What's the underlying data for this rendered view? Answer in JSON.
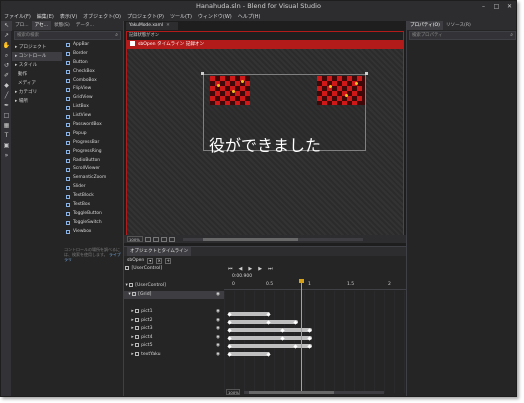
{
  "window": {
    "title": "Hanahuda.sln - Blend for Visual Studio",
    "controls": [
      "–",
      "□",
      "✕"
    ]
  },
  "menu": [
    "ファイル(F)",
    "編集(E)",
    "表示(V)",
    "オブジェクト(O)",
    "プロジェクト(P)",
    "ツール(T)",
    "ウィンドウ(W)",
    "ヘルプ(H)"
  ],
  "left_panel": {
    "tabs": [
      "プロ...",
      "アセ...",
      "状態(S)",
      "データ..."
    ],
    "search_placeholder": "検索の検索",
    "categories": [
      "プロジェクト",
      "コントロール",
      "スタイル",
      "動作",
      "メディア",
      "カテゴリ",
      "場所"
    ],
    "controls": [
      "AppBar",
      "Border",
      "Button",
      "CheckBox",
      "ComboBox",
      "FlipView",
      "GridView",
      "ListBox",
      "ListView",
      "PasswordBox",
      "Popup",
      "ProgressBar",
      "ProgressRing",
      "RadioButton",
      "ScrollViewer",
      "SemanticZoom",
      "Slider",
      "TextBlock",
      "TextBox",
      "ToggleButton",
      "ToggleSwitch",
      "Viewbox"
    ],
    "note": "コントロールの場所を調べるには、検索を使用します。",
    "note_link": "ライブラリ"
  },
  "document": {
    "tab_label": "YakuMode.xaml",
    "record_text": "記録状態がオン",
    "scope_text": "sbOpen タイムライン 記録オン",
    "canvas_text": "役ができました",
    "zoom": "100%"
  },
  "right_panel": {
    "tabs": [
      "プロパティ(O)",
      "リソース(R)"
    ],
    "search_placeholder": "検索プロパティ"
  },
  "timeline": {
    "tabs": [
      "オブジェクトとタイムライン"
    ],
    "storyboard": "sbOpen",
    "root": "[UserControl]",
    "grid": "[Grid]",
    "rows": [
      "pict1",
      "pict2",
      "pict3",
      "pict4",
      "pict5",
      "textYaku"
    ],
    "timecode": "0:00.900",
    "ruler": [
      "0",
      "0.5",
      "1",
      "1.5",
      "2"
    ],
    "zoom": "100%",
    "player_buttons": [
      "⏮",
      "◀",
      "▶",
      "▶",
      "⏭"
    ]
  }
}
